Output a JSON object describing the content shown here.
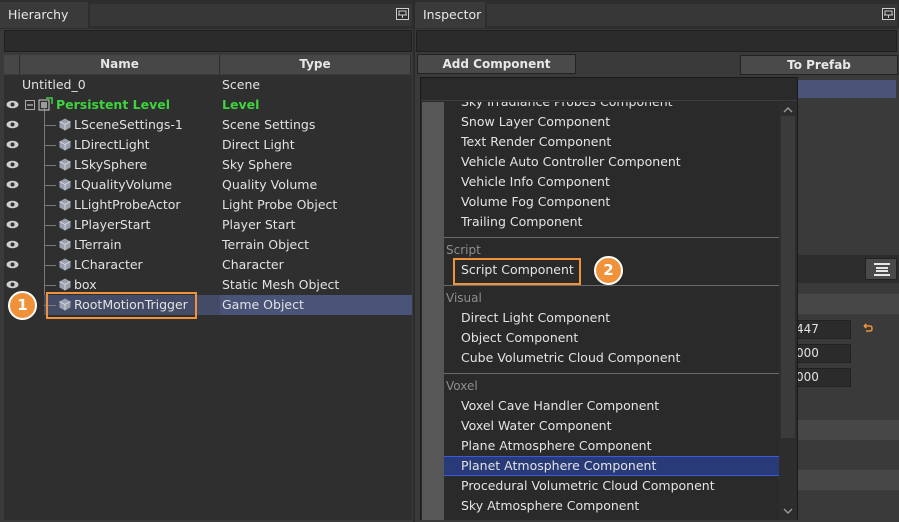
{
  "hierarchy": {
    "title": "Hierarchy",
    "columns": {
      "name": "Name",
      "type": "Type"
    },
    "rows": [
      {
        "name": "Untitled_0",
        "type": "Scene"
      },
      {
        "name": "Persistent Level",
        "type": "Level"
      },
      {
        "name": "LSceneSettings-1",
        "type": "Scene Settings"
      },
      {
        "name": "LDirectLight",
        "type": "Direct Light"
      },
      {
        "name": "LSkySphere",
        "type": "Sky Sphere"
      },
      {
        "name": "LQualityVolume",
        "type": "Quality Volume"
      },
      {
        "name": "LLightProbeActor",
        "type": "Light Probe Object"
      },
      {
        "name": "LPlayerStart",
        "type": "Player Start"
      },
      {
        "name": "LTerrain",
        "type": "Terrain Object"
      },
      {
        "name": "LCharacter",
        "type": "Character"
      },
      {
        "name": "box",
        "type": "Static Mesh Object"
      },
      {
        "name": "RootMotionTrigger",
        "type": "Game Object"
      }
    ],
    "badge": "1"
  },
  "inspector": {
    "title": "Inspector",
    "add_component_label": "Add Component",
    "to_prefab_label": "To Prefab",
    "field_values": [
      "447",
      "000",
      "000"
    ],
    "badge": "2"
  },
  "component_list": {
    "partial_top_item": "Sky Irradiance Probes Component",
    "group_items": [
      "Snow Layer Component",
      "Text Render Component",
      "Vehicle Auto Controller Component",
      "Vehicle Info Component",
      "Volume Fog Component",
      "Trailing Component"
    ],
    "categories": {
      "script": {
        "label": "Script",
        "items": [
          "Script Component"
        ]
      },
      "visual": {
        "label": "Visual",
        "items": [
          "Direct Light Component",
          "Object Component",
          "Cube Volumetric Cloud Component"
        ]
      },
      "voxel": {
        "label": "Voxel",
        "items": [
          "Voxel Cave Handler Component",
          "Voxel Water Component",
          "Plane Atmosphere Component",
          "Planet Atmosphere Component",
          "Procedural Volumetric Cloud Component",
          "Sky Atmosphere Component"
        ]
      }
    },
    "hovered_item": "Planet Atmosphere Component"
  },
  "colors": {
    "level_green": "#3dd43d",
    "highlight_orange": "#f0923a",
    "selection_blue": "#4a5478",
    "hover_blue": "#283a78"
  }
}
